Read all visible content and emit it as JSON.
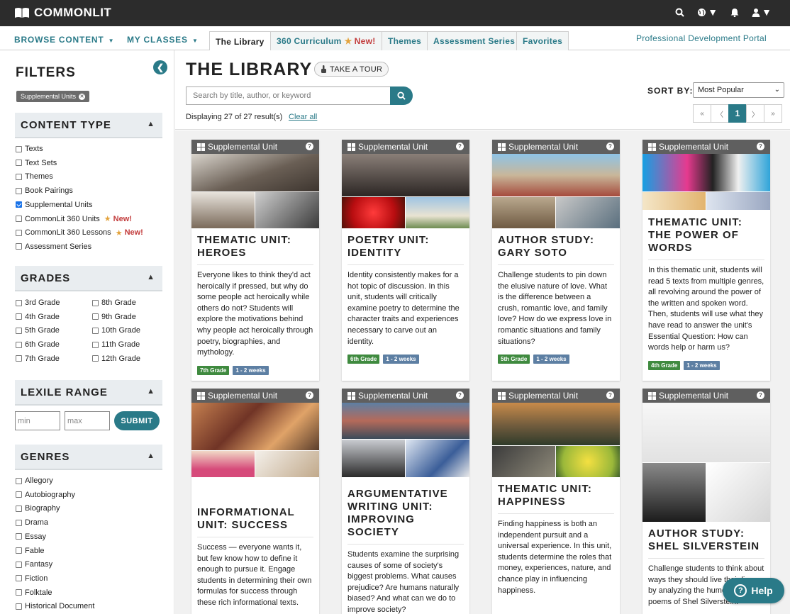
{
  "brand": {
    "name": "COMMONLIT"
  },
  "topbar": {
    "icons": [
      "search-icon",
      "globe-icon",
      "bell-icon",
      "user-icon"
    ]
  },
  "subnav": {
    "browse_content": "BROWSE CONTENT",
    "my_classes": "MY CLASSES",
    "tabs": [
      {
        "label": "The Library"
      },
      {
        "label": "360 Curriculum",
        "new": "New!"
      },
      {
        "label": "Themes"
      },
      {
        "label": "Assessment Series"
      },
      {
        "label": "Favorites"
      }
    ],
    "pdp": "Professional Development Portal"
  },
  "filters": {
    "title": "FILTERS",
    "active_chip": "Supplemental Units",
    "content_type": {
      "title": "CONTENT TYPE",
      "items": [
        {
          "label": "Texts",
          "checked": false
        },
        {
          "label": "Text Sets",
          "checked": false
        },
        {
          "label": "Themes",
          "checked": false
        },
        {
          "label": "Book Pairings",
          "checked": false
        },
        {
          "label": "Supplemental Units",
          "checked": true
        },
        {
          "label": "CommonLit 360 Units",
          "checked": false,
          "new": "New!"
        },
        {
          "label": "CommonLit 360 Lessons",
          "checked": false,
          "new": "New!"
        },
        {
          "label": "Assessment Series",
          "checked": false
        }
      ]
    },
    "grades": {
      "title": "GRADES",
      "left": [
        "3rd Grade",
        "4th Grade",
        "5th Grade",
        "6th Grade",
        "7th Grade"
      ],
      "right": [
        "8th Grade",
        "9th Grade",
        "10th Grade",
        "11th Grade",
        "12th Grade"
      ]
    },
    "lexile": {
      "title": "LEXILE RANGE",
      "min_placeholder": "min",
      "max_placeholder": "max",
      "submit": "SUBMIT"
    },
    "genres": {
      "title": "GENRES",
      "items": [
        "Allegory",
        "Autobiography",
        "Biography",
        "Drama",
        "Essay",
        "Fable",
        "Fantasy",
        "Fiction",
        "Folktale",
        "Historical Document"
      ]
    }
  },
  "library": {
    "title": "THE LIBRARY",
    "tour": "TAKE A TOUR",
    "search_placeholder": "Search by title, author, or keyword",
    "displaying": "Displaying 27 of 27 result(s)",
    "clear_all": "Clear all",
    "sort_label": "SORT BY:",
    "sort_value": "Most Popular",
    "pager": {
      "first": "«",
      "prev": "〈",
      "current": "1",
      "next": "〉",
      "last": "»"
    }
  },
  "cards": [
    {
      "type": "Supplemental Unit",
      "title_lines": [
        "THEMATIC UNIT:",
        "HEROES"
      ],
      "desc": "Everyone likes to think they'd act heroically if pressed, but why do some people act heroically while others do not? Students will explore the motivations behind why people act heroically through poetry, biographies, and mythology.",
      "grade": "7th Grade",
      "duration": "1 - 2 weeks"
    },
    {
      "type": "Supplemental Unit",
      "title_lines": [
        "POETRY UNIT:",
        "IDENTITY"
      ],
      "desc": "Identity consistently makes for a hot topic of discussion. In this unit, students will critically examine poetry to determine the character traits and experiences necessary to carve out an identity.",
      "grade": "6th Grade",
      "duration": "1 - 2 weeks"
    },
    {
      "type": "Supplemental Unit",
      "title_lines": [
        "AUTHOR STUDY:",
        "GARY SOTO"
      ],
      "desc": "Challenge students to pin down the elusive nature of love. What is the difference between a crush, romantic love, and family love? How do we express love in romantic situations and family situations?",
      "grade": "5th Grade",
      "duration": "1 - 2 weeks"
    },
    {
      "type": "Supplemental Unit",
      "title_lines": [
        "THEMATIC UNIT:",
        "THE POWER OF",
        "WORDS"
      ],
      "desc": "In this thematic unit, students will read 5 texts from multiple genres, all revolving around the power of the written and spoken word. Then, students will use what they have read to answer the unit's Essential Question: How can words help or harm us?",
      "grade": "4th Grade",
      "duration": "1 - 2 weeks"
    },
    {
      "type": "Supplemental Unit",
      "title_lines": [
        "INFORMATIONAL",
        "UNIT: SUCCESS"
      ],
      "desc": "Success — everyone wants it, but few know how to define it enough to pursue it. Engage students in determining their own formulas for success through these rich informational texts.",
      "grade": "",
      "duration": ""
    },
    {
      "type": "Supplemental Unit",
      "title_lines": [
        "ARGUMENTATIVE",
        "WRITING UNIT:",
        "IMPROVING",
        "SOCIETY"
      ],
      "desc": "Students examine the surprising causes of some of society's biggest problems. What causes prejudice? Are humans naturally biased? And what can we do to improve society?",
      "grade": "",
      "duration": ""
    },
    {
      "type": "Supplemental Unit",
      "title_lines": [
        "THEMATIC UNIT:",
        "HAPPINESS"
      ],
      "desc": "Finding happiness is both an independent pursuit and a universal experience. In this unit, students determine the roles that money, experiences, nature, and chance play in influencing happiness.",
      "grade": "",
      "duration": ""
    },
    {
      "type": "Supplemental Unit",
      "title_lines": [
        "AUTHOR STUDY:",
        "SHEL SILVERSTEIN"
      ],
      "desc": "Challenge students to think about ways they should live their lives by analyzing the humorous poems of Shel Silverstein.",
      "grade": "",
      "duration": ""
    }
  ],
  "help": {
    "label": "Help"
  }
}
